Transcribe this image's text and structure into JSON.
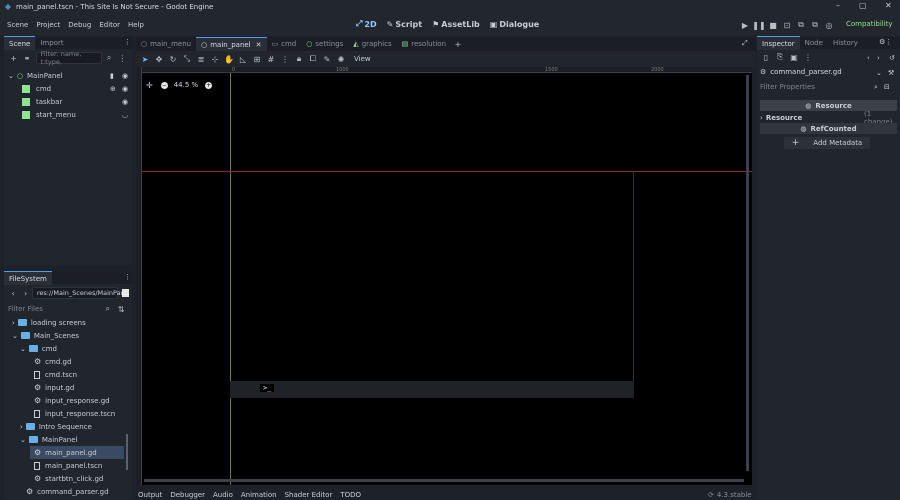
{
  "window": {
    "title": "main_panel.tscn - This Site Is Not Secure - Godot Engine",
    "min": "–",
    "max": "▢",
    "close": "✕"
  },
  "menu": {
    "items": [
      "Scene",
      "Project",
      "Debug",
      "Editor",
      "Help"
    ],
    "workspaces": [
      "2D",
      "Script",
      "AssetLib",
      "Dialogue"
    ],
    "renderer": "Compatibility"
  },
  "scene_dock": {
    "tabs": [
      "Scene",
      "Import"
    ],
    "filter_placeholder": "Filter: name, t:type,",
    "nodes": [
      "MainPanel",
      "cmd",
      "taskbar",
      "start_menu"
    ]
  },
  "filesystem": {
    "tab": "FileSystem",
    "path": "res://Main_Scenes/MainPan",
    "filter_placeholder": "Filter Files",
    "items": [
      "loading screens",
      "Main_Scenes",
      "cmd",
      "cmd.gd",
      "cmd.tscn",
      "input.gd",
      "input_response.gd",
      "input_response.tscn",
      "Intro Sequence",
      "MainPanel",
      "main_panel.gd",
      "main_panel.tscn",
      "startbtn_click.gd",
      "command_parser.gd"
    ]
  },
  "editor_tabs": [
    "main_menu",
    "main_panel",
    "cmd",
    "settings",
    "graphics",
    "resolution"
  ],
  "toolbar": {
    "view": "View"
  },
  "viewport": {
    "zoom": "44.5 %",
    "prompt": ">_",
    "ruler": [
      "0",
      "1000",
      "1500",
      "2000"
    ]
  },
  "bottom": {
    "tabs": [
      "Output",
      "Debugger",
      "Audio",
      "Animation",
      "Shader Editor",
      "TODO"
    ],
    "version": "4.3.stable"
  },
  "inspector": {
    "tabs": [
      "Inspector",
      "Node",
      "History"
    ],
    "file": "command_parser.gd",
    "filter_placeholder": "Filter Properties",
    "resource_header": "Resource",
    "resource_row": "Resource",
    "resource_change": "(1 change)",
    "refcounted": "RefCounted",
    "add_metadata": "Add Metadata"
  }
}
